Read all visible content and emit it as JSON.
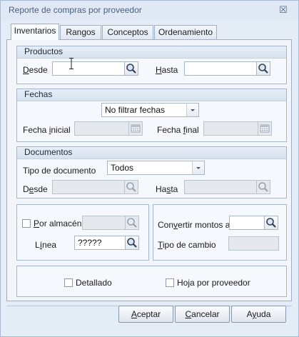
{
  "window": {
    "title": "Reporte de compras por proveedor",
    "close_glyph": "☒"
  },
  "tabs": [
    {
      "label": "Inventarios",
      "active": true
    },
    {
      "label": "Rangos"
    },
    {
      "label": "Conceptos"
    },
    {
      "label": "Ordenamiento"
    }
  ],
  "productos": {
    "header": "Productos",
    "desde_label_mn": "D",
    "desde_label_rest": "esde",
    "hasta_label_mn": "H",
    "hasta_label_rest": "asta",
    "desde_value": "",
    "hasta_value": ""
  },
  "fechas": {
    "header": "Fechas",
    "filter_value": "No filtrar fechas",
    "fecha_inicial_pre": "Fecha ",
    "fecha_inicial_mn": "i",
    "fecha_inicial_post": "nicial",
    "fecha_final_pre": "Fecha ",
    "fecha_final_mn": "f",
    "fecha_final_post": "inal"
  },
  "documentos": {
    "header": "Documentos",
    "tipo_label": "Tipo de documento",
    "tipo_value": "Todos",
    "desde_pre": "D",
    "desde_mn": "e",
    "desde_post": "sde",
    "hasta_pre": "Ha",
    "hasta_mn": "s",
    "hasta_post": "ta"
  },
  "almacen": {
    "por_almacen_mn": "P",
    "por_almacen_rest": "or almacén",
    "linea_pre": "L",
    "linea_mn": "í",
    "linea_post": "nea",
    "linea_value": "?????"
  },
  "montos": {
    "convertir_pre": "Con",
    "convertir_mn": "v",
    "convertir_post": "ertir montos a",
    "tipo_cambio_mn": "T",
    "tipo_cambio_rest": "ipo de cambio",
    "convertir_value": "",
    "tipo_cambio_value": ""
  },
  "opciones": {
    "detallado": "Detallado",
    "hoja": "Hoja por proveedor"
  },
  "buttons": {
    "aceptar_mn": "A",
    "aceptar_rest": "ceptar",
    "cancelar_mn": "C",
    "cancelar_rest": "ancelar",
    "ayuda_pre": "A",
    "ayuda_mn": "y",
    "ayuda_post": "uda"
  },
  "colors": {
    "accent": "#9db0c9",
    "background": "#e4ecf6",
    "group_header": "#d6e1ef"
  }
}
